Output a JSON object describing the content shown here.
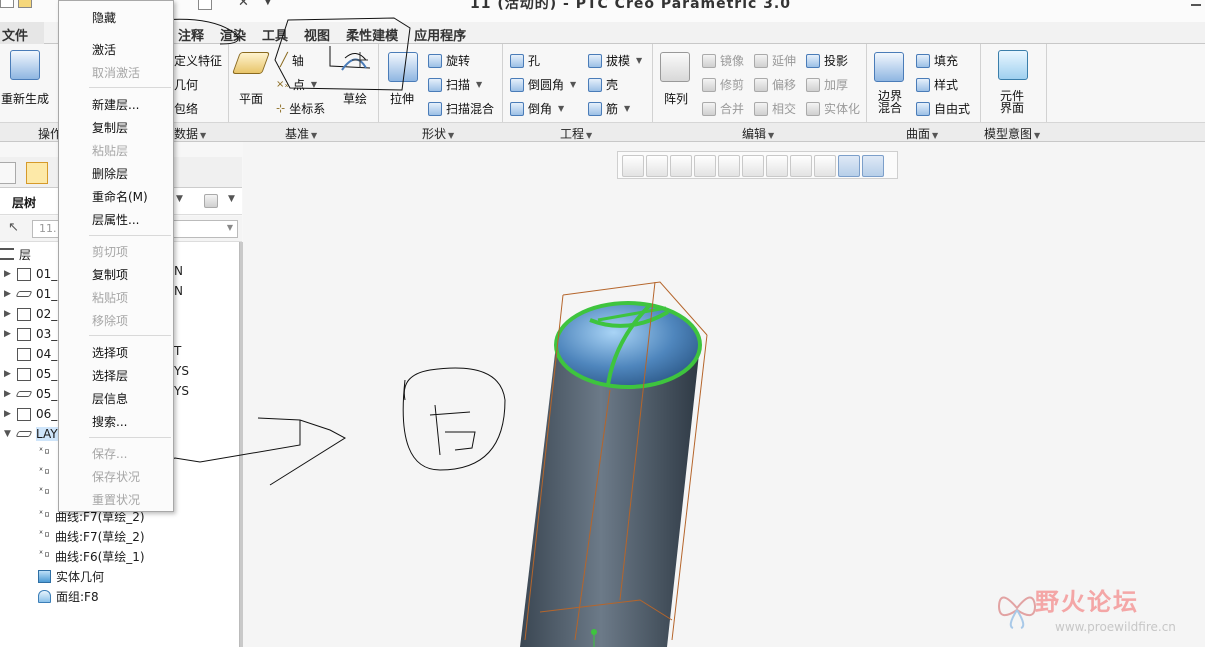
{
  "window": {
    "title": "11 (活动的) - PTC Creo Parametric 3.0"
  },
  "menu_tabs": [
    {
      "label": "文件",
      "dropdown": true
    },
    {
      "label": "注释"
    },
    {
      "label": "渲染"
    },
    {
      "label": "工具"
    },
    {
      "label": "视图"
    },
    {
      "label": "柔性建模"
    },
    {
      "label": "应用程序"
    }
  ],
  "ribbon": {
    "regenerate": "重新生成",
    "user_defined_feature": "定义特征",
    "copy_geometry": "几何",
    "shrinkwrap": "包络",
    "plane": "平面",
    "axis": "轴",
    "point": "点",
    "csys": "坐标系",
    "sketch": "草绘",
    "extrude": "拉伸",
    "revolve": "旋转",
    "sweep": "扫描",
    "swept_blend": "扫描混合",
    "hole": "孔",
    "round": "倒圆角",
    "chamfer": "倒角",
    "draft": "拔模",
    "shell": "壳",
    "rib": "筋",
    "pattern": "阵列",
    "mirror": "镜像",
    "trim": "修剪",
    "merge": "合并",
    "extend": "延伸",
    "offset": "偏移",
    "intersect": "相交",
    "project": "投影",
    "thicken": "加厚",
    "solidify": "实体化",
    "boundary_blend": "边界\n混合",
    "fill": "填充",
    "style": "样式",
    "freestyle": "自由式",
    "component_interface": "元件\n界面"
  },
  "group_labels": {
    "operations": "操作",
    "get_data": "数据",
    "datum": "基准",
    "shapes": "形状",
    "engineering": "工程",
    "editing": "编辑",
    "surfaces": "曲面",
    "model_intent": "模型意图"
  },
  "left_panel": {
    "header": "层树",
    "filter_placeholder": "11."
  },
  "layer_tree": [
    {
      "label": "层",
      "kind": "root"
    },
    {
      "label": "01_",
      "suffix": "N",
      "icon": "layer-icon"
    },
    {
      "label": "01_",
      "suffix": "N",
      "icon": "layer-thin-icon"
    },
    {
      "label": "02_",
      "suffix": "",
      "icon": "layer-icon"
    },
    {
      "label": "03_",
      "suffix": "",
      "icon": "layer-icon"
    },
    {
      "label": "04_",
      "suffix": "T",
      "icon": "layer-icon"
    },
    {
      "label": "05_",
      "suffix": "YS",
      "icon": "layer-icon"
    },
    {
      "label": "05_",
      "suffix": "YS",
      "icon": "layer-thin-icon"
    },
    {
      "label": "06_",
      "suffix": "",
      "icon": "layer-icon"
    },
    {
      "label": "LAY",
      "suffix": "",
      "icon": "layer-thin-icon",
      "selected": true
    }
  ],
  "layer_children": [
    {
      "label": "曲线:F7(草绘_2)"
    },
    {
      "label": "曲线:F7(草绘_2)"
    },
    {
      "label": "曲线:F6(草绘_1)"
    },
    {
      "label": "实体几何"
    },
    {
      "label": "面组:F8"
    }
  ],
  "context_menu": [
    {
      "label": "隐藏",
      "enabled": true
    },
    {
      "label": "激活",
      "enabled": true
    },
    {
      "label": "取消激活",
      "enabled": false
    },
    {
      "sep": true
    },
    {
      "label": "新建层...",
      "enabled": true
    },
    {
      "label": "复制层",
      "enabled": true
    },
    {
      "label": "粘贴层",
      "enabled": false
    },
    {
      "label": "删除层",
      "enabled": true
    },
    {
      "label": "重命名(M)",
      "enabled": true
    },
    {
      "label": "层属性...",
      "enabled": true
    },
    {
      "sep": true
    },
    {
      "label": "剪切项",
      "enabled": false
    },
    {
      "label": "复制项",
      "enabled": true
    },
    {
      "label": "粘贴项",
      "enabled": false
    },
    {
      "label": "移除项",
      "enabled": false
    },
    {
      "sep": true
    },
    {
      "label": "选择项",
      "enabled": true
    },
    {
      "label": "选择层",
      "enabled": true
    },
    {
      "label": "层信息",
      "enabled": true
    },
    {
      "label": "搜索...",
      "enabled": true
    },
    {
      "sep": true
    },
    {
      "label": "保存...",
      "enabled": false
    },
    {
      "label": "保存状况",
      "enabled": false
    },
    {
      "label": "重置状况",
      "enabled": false
    }
  ],
  "watermark": {
    "name": "野火论坛",
    "url": "www.proewildfire.cn"
  },
  "colors": {
    "accent": "#4a7cb8",
    "highlight": "#3ec43e",
    "model": "#4e5d6c",
    "datum_curve": "#b5652b"
  }
}
